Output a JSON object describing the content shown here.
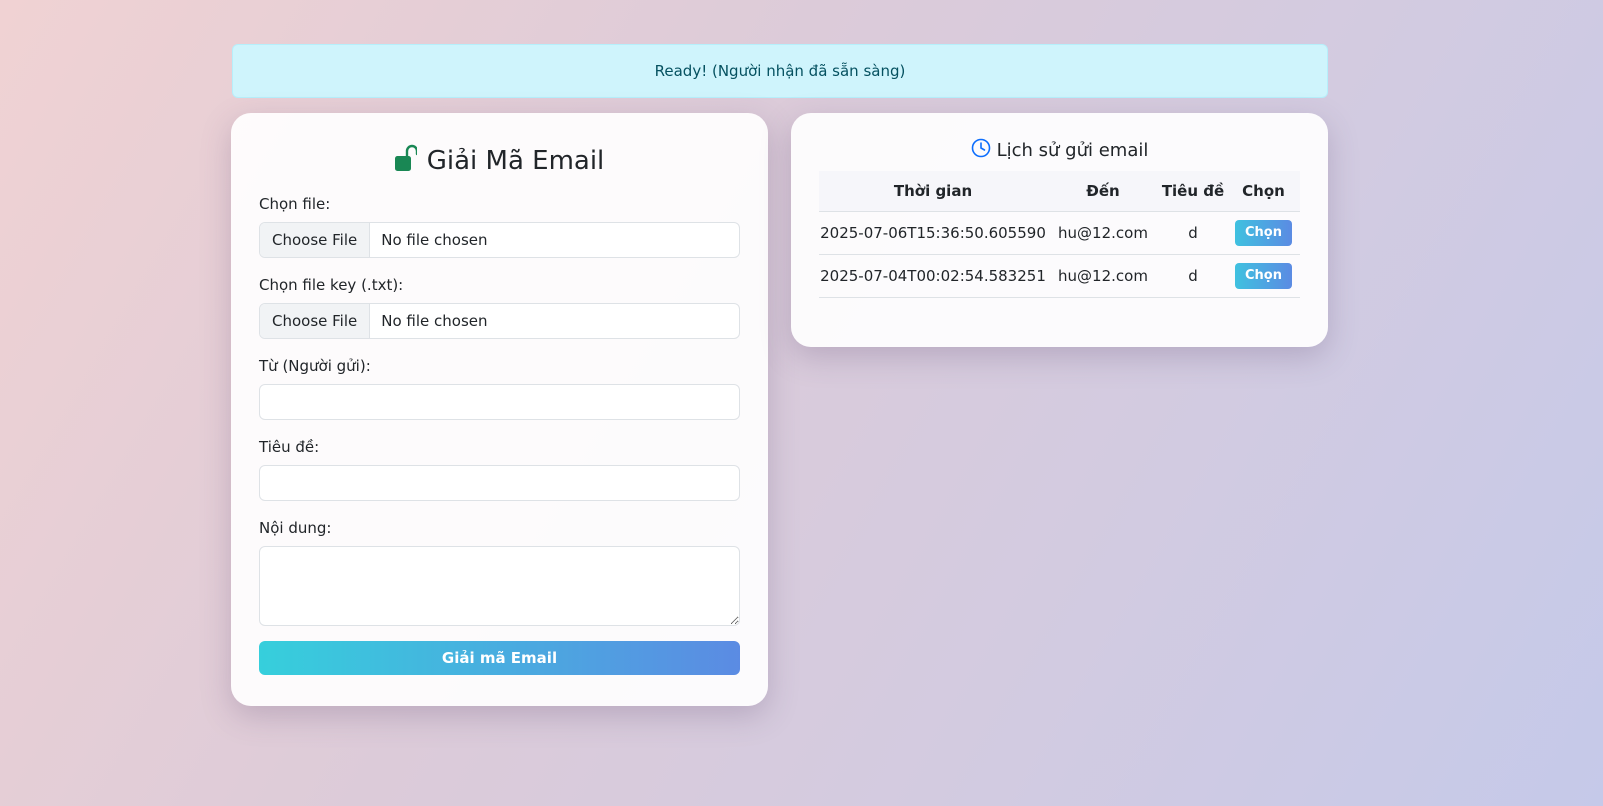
{
  "alert": {
    "text": "Ready! (Người nhận đã sẵn sàng)"
  },
  "decrypt": {
    "title": "Giải Mã Email",
    "icon": "unlock-icon",
    "icon_color": "#198754",
    "file_label": "Chọn file:",
    "key_label": "Chọn file key (.txt):",
    "choose_button": "Choose File",
    "no_file": "No file chosen",
    "from_label": "Từ (Người gửi):",
    "from_value": "",
    "subject_label": "Tiêu đề:",
    "subject_value": "",
    "content_label": "Nội dung:",
    "content_value": "",
    "submit_label": "Giải mã Email"
  },
  "history": {
    "title": "Lịch sử gửi email",
    "icon": "clock-icon",
    "icon_color": "#0d6efd",
    "columns": [
      "Thời gian",
      "Đến",
      "Tiêu đề",
      "Chọn"
    ],
    "rows": [
      {
        "time": "2025-07-06T15:36:50.605590",
        "to": "hu@12.com",
        "subject": "d",
        "action": "Chọn"
      },
      {
        "time": "2025-07-04T00:02:54.583251",
        "to": "hu@12.com",
        "subject": "d",
        "action": "Chọn"
      }
    ]
  }
}
